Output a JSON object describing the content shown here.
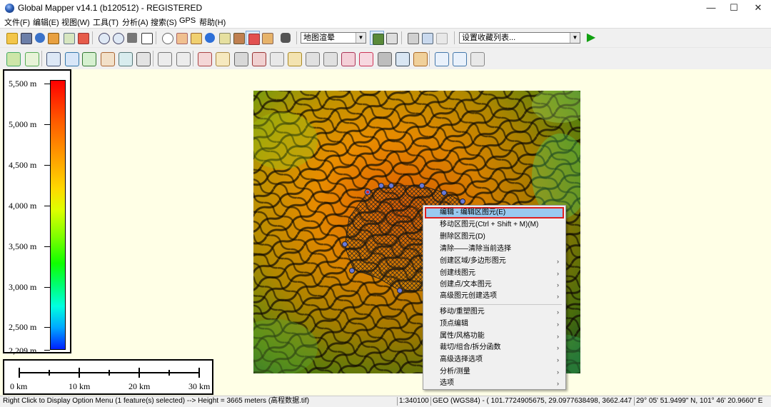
{
  "window": {
    "title": "Global Mapper v14.1 (b120512) - REGISTERED",
    "minimize": "—",
    "maximize": "☐",
    "close": "✕"
  },
  "menu": [
    "文件(F)",
    "编辑(E)",
    "视图(W)",
    "工具(T)",
    "分析(A)",
    "搜索(S)",
    "GPS",
    "帮助(H)"
  ],
  "toolbar": {
    "shader_combo": "地图渲晕",
    "favorites_combo": "设置收藏列表...",
    "run_button": "▶"
  },
  "legend": {
    "labels": [
      "5,500 m",
      "5,000 m",
      "4,500 m",
      "4,000 m",
      "3,500 m",
      "3,000 m",
      "2,500 m",
      "2,209 m"
    ],
    "colors": {
      "high": "#ff0000",
      "mid": "#ffd800",
      "low": "#0020ff"
    }
  },
  "scale": {
    "labels": [
      "0 km",
      "10 km",
      "20 km",
      "30 km"
    ]
  },
  "context_menu": {
    "items": [
      {
        "label": "编辑 - 编辑区图元(E)",
        "submenu": false,
        "highlighted": true
      },
      {
        "label": "移动区图元(Ctrl + Shift + M)(M)",
        "submenu": false
      },
      {
        "label": "删除区图元(D)",
        "submenu": false
      },
      {
        "label": "清除——清除当前选择",
        "submenu": false
      },
      {
        "label": "创建区域/多边形图元",
        "submenu": true
      },
      {
        "label": "创建线图元",
        "submenu": true
      },
      {
        "label": "创建点/文本图元",
        "submenu": true
      },
      {
        "label": "高级图元创建选项",
        "submenu": true
      },
      {
        "label": "移动/重塑图元",
        "submenu": true
      },
      {
        "label": "顶点编辑",
        "submenu": true
      },
      {
        "label": "属性/风格功能",
        "submenu": true
      },
      {
        "label": "裁切/组合/拆分函数",
        "submenu": true
      },
      {
        "label": "高级选择选项",
        "submenu": true
      },
      {
        "label": "分析/测量",
        "submenu": true
      },
      {
        "label": "选项",
        "submenu": true
      }
    ],
    "submenu_glyph": "›"
  },
  "status": {
    "message": "Right Click to Display Option Menu (1 feature(s) selected) --> Height = 3665 meters (高程数据.tif)",
    "scale": "1:340100",
    "coords": "GEO (WGS84) - ( 101.7724905675, 29.0977638498, 3662.447 m )",
    "dms": "29° 05' 51.9499\" N, 101° 46' 20.9660\" E"
  }
}
